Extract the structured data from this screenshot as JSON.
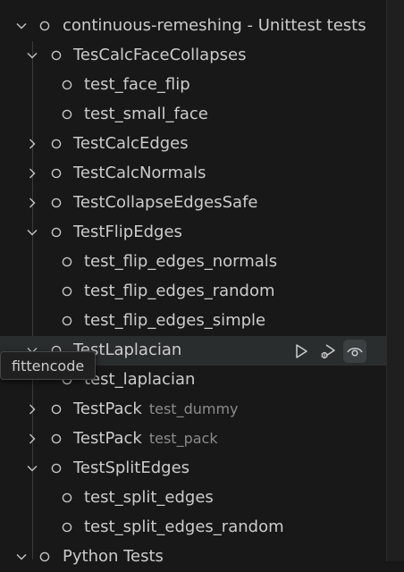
{
  "tree": {
    "root": {
      "label": "continuous-remeshing - Unittest tests"
    },
    "suites": [
      {
        "label": "TesCalcFaceCollapses",
        "expanded": true,
        "tests": [
          "test_face_flip",
          "test_small_face"
        ]
      },
      {
        "label": "TestCalcEdges",
        "expanded": false
      },
      {
        "label": "TestCalcNormals",
        "expanded": false
      },
      {
        "label": "TestCollapseEdgesSafe",
        "expanded": false
      },
      {
        "label": "TestFlipEdges",
        "expanded": true,
        "tests": [
          "test_flip_edges_normals",
          "test_flip_edges_random",
          "test_flip_edges_simple"
        ]
      },
      {
        "label": "TestLaplacian",
        "expanded": true,
        "tests": [
          "test_laplacian"
        ]
      },
      {
        "label": "TestPack",
        "description": "test_dummy",
        "expanded": false
      },
      {
        "label": "TestPack",
        "description": "test_pack",
        "expanded": false
      },
      {
        "label": "TestSplitEdges",
        "expanded": true,
        "tests": [
          "test_split_edges",
          "test_split_edges_random"
        ]
      }
    ],
    "next_root": {
      "label": "Python Tests"
    }
  },
  "hover_actions": {
    "run_icon": "run-test-icon",
    "debug_icon": "debug-test-icon",
    "watch_icon": "continuous-run-icon"
  },
  "tooltip": {
    "text": "fittencode"
  },
  "colors": {
    "background": "#181818",
    "text": "#cccccc",
    "description": "#8b8b8b",
    "hover_row": "#2a2d2e",
    "tooltip_bg": "#202020"
  }
}
